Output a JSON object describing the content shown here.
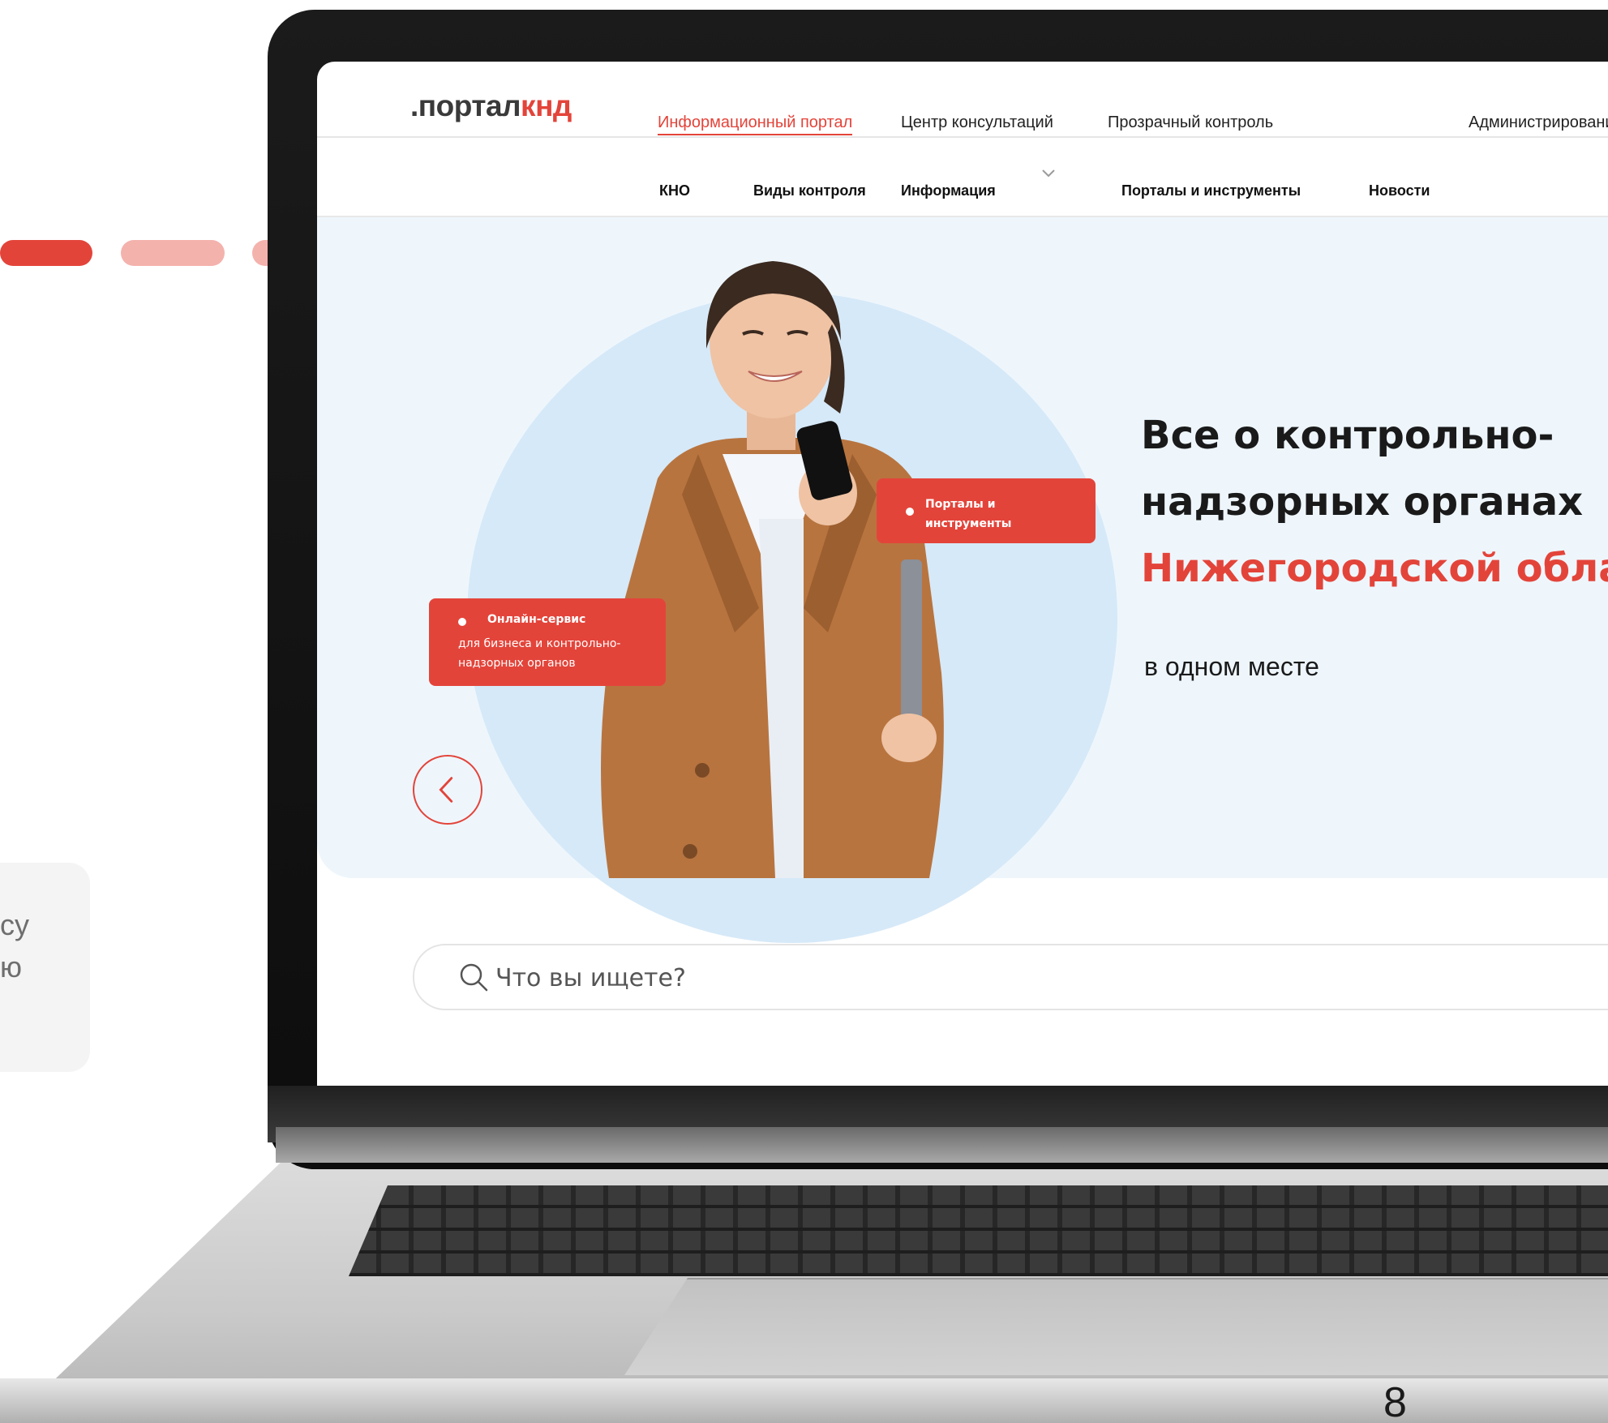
{
  "slide": {
    "side_text_line1": "су",
    "side_text_line2": "ю",
    "page_number": "8"
  },
  "site": {
    "logo_prefix": ".портал",
    "logo_suffix": "кнд",
    "top_nav": [
      {
        "label": "Информационный портал",
        "active": true
      },
      {
        "label": "Центр консультаций",
        "active": false
      },
      {
        "label": "Прозрачный контроль",
        "active": false
      },
      {
        "label": "Администрировани",
        "active": false
      }
    ],
    "sub_nav": [
      "КНО",
      "Виды контроля",
      "Информация",
      "Порталы и инструменты",
      "Новости"
    ],
    "badge_portals": "Порталы и инструменты",
    "badge_online_title": "Онлайн-сервис",
    "badge_online_text": "для бизнеса и контрольно-надзорных органов",
    "headline_line1": "Все о контрольно-",
    "headline_line2": "надзорных органах",
    "headline_accent": "Нижегородской област",
    "tagline": "в одном месте",
    "search_placeholder": "Что вы ищете?"
  },
  "colors": {
    "accent": "#e3443a",
    "hero_bg": "#eef6fc"
  },
  "icons": {
    "search": "search-icon",
    "back": "chevron-left-icon",
    "dropdown": "chevron-down-icon"
  }
}
